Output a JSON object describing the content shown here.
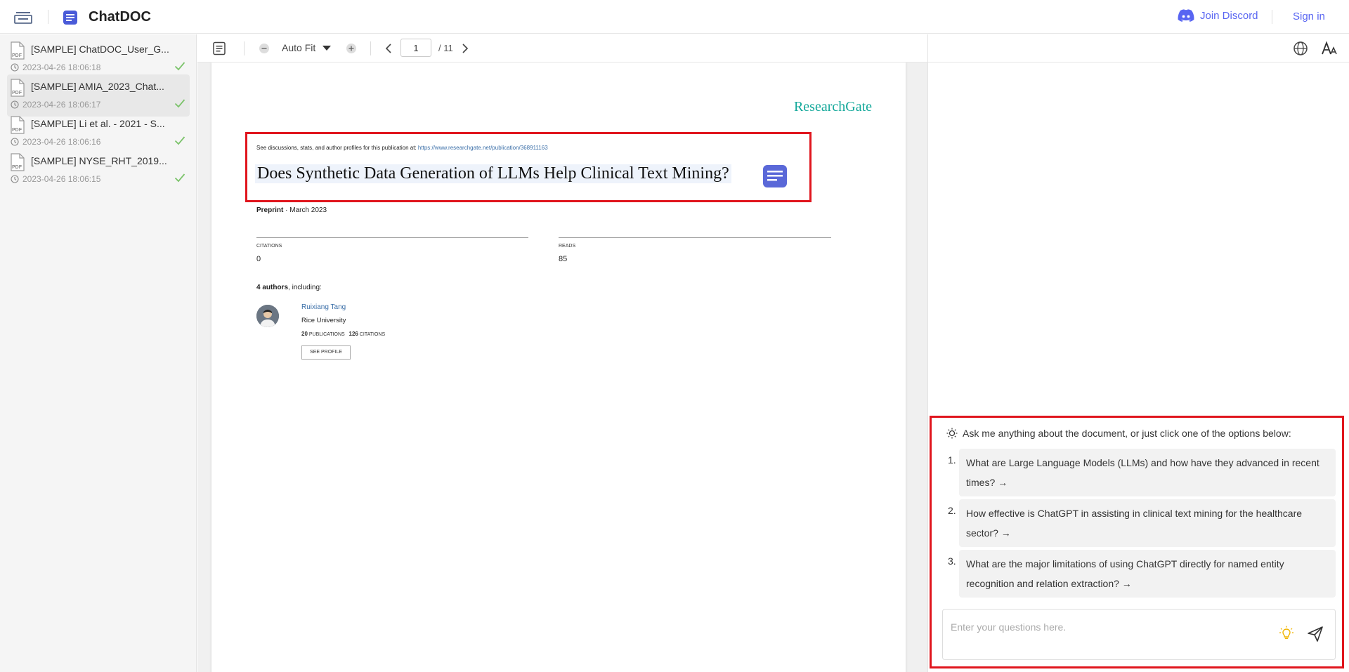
{
  "header": {
    "app_title": "ChatDOC",
    "discord_label": "Join Discord",
    "signin_label": "Sign in",
    "accent_color": "#5865f2"
  },
  "sidebar": {
    "items": [
      {
        "name": "[SAMPLE] ChatDOC_User_G...",
        "time": "2023-04-26 18:06:18",
        "active": false,
        "icon": "pdf-icon",
        "status_icon": "check-icon"
      },
      {
        "name": "[SAMPLE] AMIA_2023_Chat...",
        "time": "2023-04-26 18:06:17",
        "active": true,
        "icon": "pdf-icon",
        "status_icon": "check-icon"
      },
      {
        "name": "[SAMPLE] Li et al. - 2021 - S...",
        "time": "2023-04-26 18:06:16",
        "active": false,
        "icon": "pdf-icon",
        "status_icon": "check-icon"
      },
      {
        "name": "[SAMPLE] NYSE_RHT_2019...",
        "time": "2023-04-26 18:06:15",
        "active": false,
        "icon": "pdf-icon",
        "status_icon": "check-icon"
      }
    ]
  },
  "pdf_toolbar": {
    "zoom_label": "Auto Fit",
    "current_page": "1",
    "total_pages": "/ 11"
  },
  "pdf_page": {
    "logo": "ResearchGate",
    "see_discussions": "See discussions, stats, and author profiles for this publication at:",
    "link": "https://www.researchgate.net/publication/368911163",
    "title": "Does Synthetic Data Generation of LLMs Help Clinical Text Mining?",
    "preprint_label": "Preprint",
    "preprint_date": "· March 2023",
    "citations_label": "CITATIONS",
    "citations_value": "0",
    "reads_label": "READS",
    "reads_value": "85",
    "authors_count": "4 authors",
    "authors_suffix": ", including:",
    "author_name": "Ruixiang Tang",
    "author_institution": "Rice University",
    "publications_count": "20",
    "publications_label": "PUBLICATIONS",
    "author_citations_count": "126",
    "author_citations_label": "CITATIONS",
    "see_profile": "SEE PROFILE",
    "highlight_color": "#e0151d",
    "logo_color": "#16a99b"
  },
  "chat": {
    "prompt": "Ask me anything about the document, or just click one of the options below:",
    "suggestions": [
      {
        "num": "1.",
        "text": "What are Large Language Models (LLMs) and how have they advanced in recent times? →"
      },
      {
        "num": "2.",
        "text": "How effective is ChatGPT in assisting in clinical text mining for the healthcare sector? →"
      },
      {
        "num": "3.",
        "text": "What are the major limitations of using ChatGPT directly for named entity recognition and relation extraction? →"
      }
    ],
    "input_placeholder": "Enter your questions here."
  }
}
